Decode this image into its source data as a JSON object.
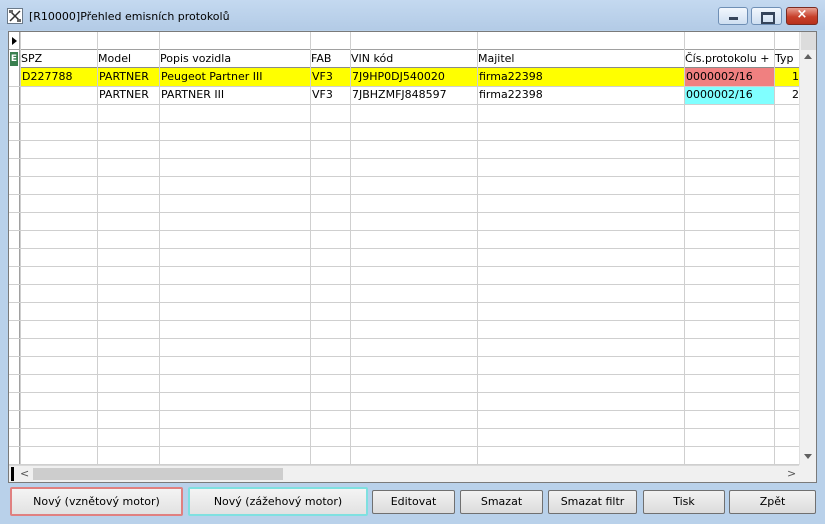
{
  "window": {
    "title": "[R10000]Přehled emisních protokolů",
    "icon": "tools-icon",
    "controls": {
      "minimize": "minimize",
      "maximize": "maximize",
      "close": "×"
    }
  },
  "grid": {
    "header_indicator": "E",
    "columns": [
      "SPZ",
      "Model",
      "Popis vozidla",
      "FAB",
      "VIN kód",
      "Majitel",
      "Čís.protokolu +",
      "Typ"
    ],
    "rows": [
      {
        "spz": "D227788",
        "model": "PARTNER",
        "popis": "Peugeot Partner III",
        "fab": "VF3",
        "vin": "7J9HP0DJ540020",
        "majitel": "firma22398",
        "protokol": "0000002/16",
        "typ": "1"
      },
      {
        "spz": "",
        "model": "PARTNER",
        "popis": "PARTNER III",
        "fab": "VF3",
        "vin": "7JBHZMFJ848597",
        "majitel": "firma22398",
        "protokol": "0000002/16",
        "typ": "2"
      }
    ],
    "colors": {
      "selected_row": "#ffff00",
      "protocol_red": "#f08080",
      "protocol_cyan": "#80ffff"
    }
  },
  "buttons": {
    "novy_vznet": "Nový (vznětový motor)",
    "novy_zazeh": "Nový (zážehový motor)",
    "editovat": "Editovat",
    "smazat": "Smazat",
    "smazat_filtr": "Smazat filtr",
    "tisk": "Tisk",
    "zpet": "Zpět"
  }
}
